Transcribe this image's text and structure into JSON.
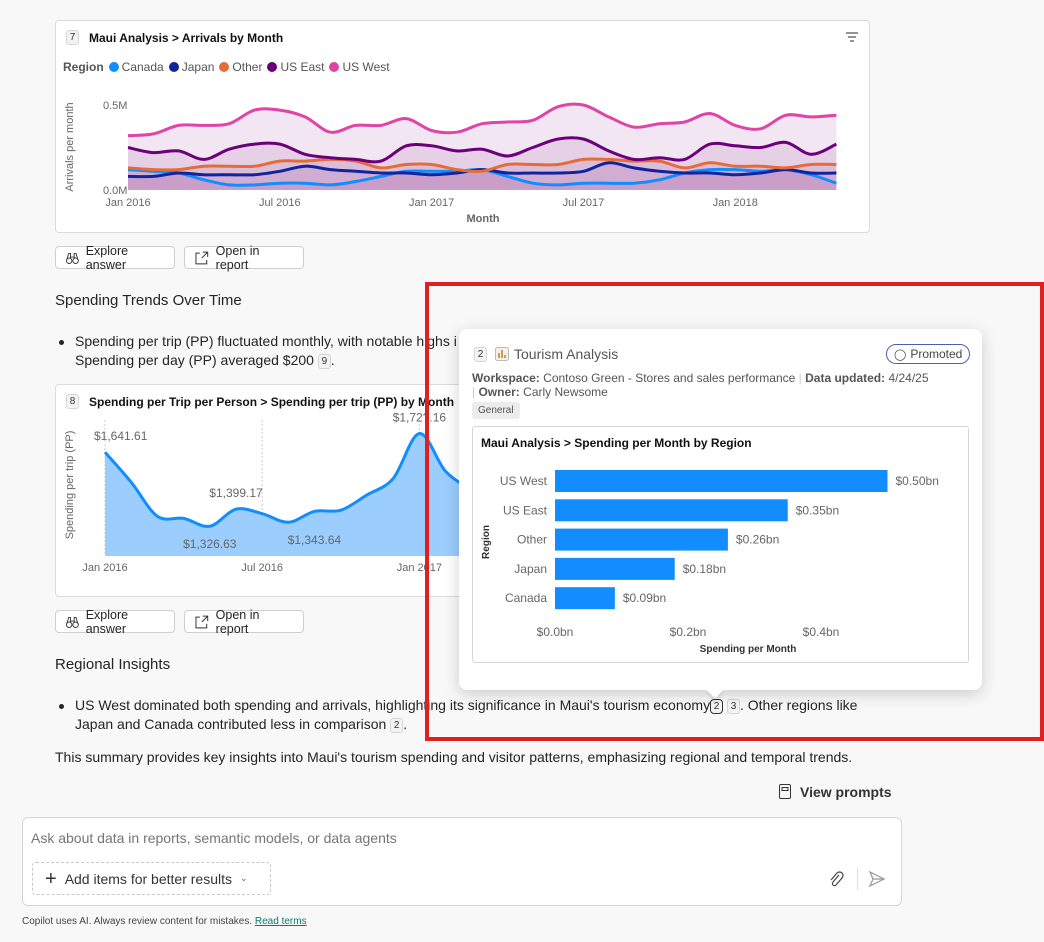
{
  "arrivals_card": {
    "cite": "7",
    "title": "Maui Analysis > Arrivals by Month",
    "legend_title": "Region",
    "ylabel": "Arrivals per month",
    "xlabel": "Month"
  },
  "actions": {
    "explore": "Explore answer",
    "open": "Open in report"
  },
  "section1": {
    "heading": "Spending Trends Over Time",
    "line1": "Spending per trip (PP) fluctuated monthly, with notable highs i",
    "line2": "Spending per day (PP) averaged $200",
    "cite": "9",
    "end": "."
  },
  "spending_card": {
    "cite": "8",
    "title": "Spending per Trip per Person > Spending per trip (PP) by Month",
    "ylabel": "Spending per trip (PP)"
  },
  "section2": {
    "heading": "Regional Insights",
    "line1": "US West dominated both spending and arrivals, highlighting its significance in Maui's tourism economy",
    "cite_a": "2",
    "cite_b": "3",
    "line1_end": ". Other regions like",
    "line2": "Japan and Canada contributed less in comparison",
    "cite_c": "2",
    "line2_end": "."
  },
  "summary": "This summary provides key insights into Maui's tourism spending and visitor patterns, emphasizing regional and temporal trends.",
  "view_prompts": "View prompts",
  "input": {
    "placeholder": "Ask about data in reports, semantic models, or data agents",
    "add_items": "Add items for better results"
  },
  "footer": {
    "text": "Copilot uses AI. Always review content for mistakes.",
    "link": "Read terms"
  },
  "popover": {
    "cite": "2",
    "title": "Tourism Analysis",
    "badge": "Promoted",
    "workspace_label": "Workspace:",
    "workspace": "Contoso Green - Stores and sales performance",
    "updated_label": "Data updated:",
    "updated": "4/24/25",
    "owner_label": "Owner:",
    "owner": "Carly Newsome",
    "tag": "General"
  },
  "colors": {
    "canada": "#118dff",
    "japan": "#12239e",
    "other": "#e66c37",
    "us_east": "#6b007b",
    "us_west": "#e044a7",
    "bar": "#118dff",
    "highlight": "#e02020"
  },
  "chart_data": [
    {
      "type": "line",
      "title": "Maui Analysis > Arrivals by Month",
      "xlabel": "Month",
      "ylabel": "Arrivals per month",
      "x_ticks": [
        "Jan 2016",
        "Jul 2016",
        "Jan 2017",
        "Jul 2017",
        "Jan 2018"
      ],
      "y_ticks": [
        "0.0M",
        "0.5M"
      ],
      "ylim": [
        0,
        0.5
      ],
      "x_start": "Jan 2016",
      "months": 29,
      "legend": "top-left",
      "series": [
        {
          "name": "Canada",
          "color": "#118dff",
          "values": [
            0.12,
            0.11,
            0.1,
            0.06,
            0.03,
            0.03,
            0.04,
            0.04,
            0.03,
            0.05,
            0.08,
            0.11,
            0.11,
            0.11,
            0.12,
            0.08,
            0.04,
            0.03,
            0.04,
            0.04,
            0.04,
            0.06,
            0.1,
            0.12,
            0.12,
            0.11,
            0.12,
            0.09,
            0.04
          ]
        },
        {
          "name": "Japan",
          "color": "#12239e",
          "values": [
            0.08,
            0.08,
            0.1,
            0.09,
            0.09,
            0.09,
            0.11,
            0.14,
            0.12,
            0.11,
            0.1,
            0.1,
            0.09,
            0.1,
            0.12,
            0.1,
            0.1,
            0.1,
            0.11,
            0.16,
            0.13,
            0.11,
            0.1,
            0.1,
            0.09,
            0.1,
            0.12,
            0.1,
            0.1
          ]
        },
        {
          "name": "Other",
          "color": "#e66c37",
          "values": [
            0.13,
            0.12,
            0.12,
            0.14,
            0.14,
            0.14,
            0.17,
            0.17,
            0.18,
            0.17,
            0.13,
            0.15,
            0.15,
            0.12,
            0.11,
            0.15,
            0.15,
            0.15,
            0.18,
            0.18,
            0.17,
            0.17,
            0.13,
            0.16,
            0.14,
            0.14,
            0.13,
            0.15,
            0.15
          ]
        },
        {
          "name": "US East",
          "color": "#6b007b",
          "values": [
            0.25,
            0.22,
            0.23,
            0.18,
            0.24,
            0.27,
            0.27,
            0.21,
            0.19,
            0.18,
            0.17,
            0.26,
            0.26,
            0.23,
            0.24,
            0.2,
            0.25,
            0.3,
            0.3,
            0.23,
            0.18,
            0.19,
            0.18,
            0.27,
            0.26,
            0.25,
            0.28,
            0.21,
            0.27
          ]
        },
        {
          "name": "US West",
          "color": "#e044a7",
          "values": [
            0.32,
            0.33,
            0.38,
            0.38,
            0.39,
            0.47,
            0.47,
            0.43,
            0.34,
            0.38,
            0.38,
            0.42,
            0.35,
            0.34,
            0.39,
            0.4,
            0.41,
            0.49,
            0.5,
            0.43,
            0.37,
            0.39,
            0.4,
            0.45,
            0.38,
            0.36,
            0.44,
            0.43,
            0.44
          ]
        }
      ]
    },
    {
      "type": "area",
      "title": "Spending per Trip per Person > Spending per trip (PP) by Month",
      "ylabel": "Spending per trip (PP)",
      "x_ticks": [
        "Jan 2016",
        "Jul 2016",
        "Jan 2017"
      ],
      "ylim": [
        1200,
        1800
      ],
      "x": [
        "Jan 2016",
        "Feb 2016",
        "Mar 2016",
        "Apr 2016",
        "May 2016",
        "Jun 2016",
        "Jul 2016",
        "Aug 2016",
        "Sep 2016",
        "Oct 2016",
        "Nov 2016",
        "Dec 2016",
        "Jan 2017",
        "Feb 2017",
        "Mar 2017"
      ],
      "values": [
        1641.61,
        1514,
        1369,
        1360,
        1326.63,
        1399.17,
        1380,
        1343.64,
        1390,
        1395,
        1460,
        1530,
        1721.16,
        1560,
        1480
      ],
      "data_labels": [
        {
          "i": 0,
          "text": "$1,641.61",
          "pos": "above"
        },
        {
          "i": 4,
          "text": "$1,326.63",
          "pos": "below"
        },
        {
          "i": 5,
          "text": "$1,399.17",
          "pos": "above"
        },
        {
          "i": 7,
          "text": "$1,343.64",
          "pos": "below"
        },
        {
          "i": 12,
          "text": "$1,72?.16",
          "pos": "above"
        }
      ]
    },
    {
      "type": "bar",
      "orientation": "horizontal",
      "title": "Maui Analysis > Spending per Month by Region",
      "xlabel": "Spending per Month",
      "ylabel": "Region",
      "categories": [
        "US West",
        "US East",
        "Other",
        "Japan",
        "Canada"
      ],
      "values": [
        0.5,
        0.35,
        0.26,
        0.18,
        0.09
      ],
      "data_labels": [
        "$0.50bn",
        "$0.35bn",
        "$0.26bn",
        "$0.18bn",
        "$0.09bn"
      ],
      "x_ticks": [
        "$0.0bn",
        "$0.2bn",
        "$0.4bn"
      ],
      "xlim": [
        0,
        0.5
      ]
    }
  ]
}
